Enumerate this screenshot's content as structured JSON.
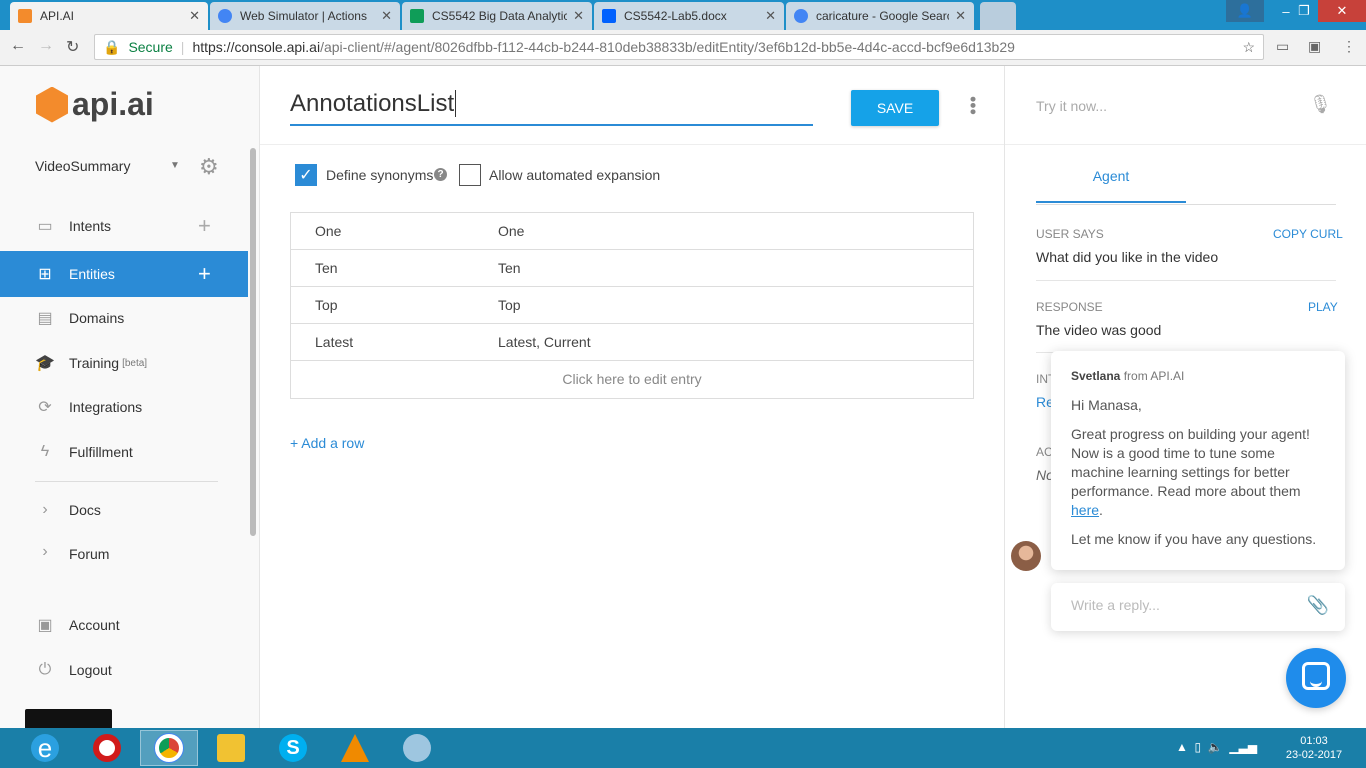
{
  "browser": {
    "tabs": [
      {
        "title": "API.AI",
        "color": "#f38b2c"
      },
      {
        "title": "Web Simulator | Actions",
        "color": "#4285f4"
      },
      {
        "title": "CS5542 Big Data Analytic",
        "color": "#0f9d58"
      },
      {
        "title": "CS5542-Lab5.docx",
        "color": "#0061fe"
      },
      {
        "title": "caricature - Google Searc",
        "color": "#4285f4"
      }
    ],
    "secure_label": "Secure",
    "url_main": "https://console.api.ai",
    "url_rest": "/api-client/#/agent/8026dfbb-f112-44cb-b244-810deb38833b/editEntity/3ef6b12d-bb5e-4d4c-accd-bcf9e6d13b29",
    "window_controls": {
      "min": "–",
      "max": "❐",
      "close": "✕"
    }
  },
  "sidebar": {
    "logo_text": "api.ai",
    "agent_name": "VideoSummary",
    "items": [
      {
        "label": "Intents",
        "icon": "chat-icon"
      },
      {
        "label": "Entities",
        "icon": "sitemap-icon"
      },
      {
        "label": "Domains",
        "icon": "book-icon"
      },
      {
        "label": "Training",
        "icon": "graduation-cap-icon",
        "badge": "[beta]"
      },
      {
        "label": "Integrations",
        "icon": "sync-icon"
      },
      {
        "label": "Fulfillment",
        "icon": "bolt-icon"
      },
      {
        "label": "Docs",
        "icon": "chevron-right-icon"
      },
      {
        "label": "Forum",
        "icon": "chevron-right-icon"
      },
      {
        "label": "Account",
        "icon": "person-icon"
      },
      {
        "label": "Logout",
        "icon": "power-icon"
      }
    ]
  },
  "main": {
    "entity_name": "AnnotationsList",
    "save_label": "SAVE",
    "define_synonyms_label": "Define synonyms",
    "allow_expansion_label": "Allow automated expansion",
    "define_synonyms_checked": true,
    "allow_expansion_checked": false,
    "rows": [
      {
        "value": "One",
        "synonyms": "One"
      },
      {
        "value": "Ten",
        "synonyms": "Ten"
      },
      {
        "value": "Top",
        "synonyms": "Top"
      },
      {
        "value": "Latest",
        "synonyms": "Latest, Current"
      }
    ],
    "edit_entry_label": "Click here to edit entry",
    "add_row_label": "+ Add a row"
  },
  "right": {
    "try_placeholder": "Try it now...",
    "tab_label": "Agent",
    "user_says_label": "USER SAYS",
    "copy_curl_label": "COPY CURL",
    "user_says_value": "What did you like in the video",
    "response_label": "RESPONSE",
    "play_label": "PLAY",
    "response_value": "The video was good",
    "intent_label_partial": "INT",
    "intent_value_partial": "Re",
    "action_label_partial": "AC",
    "action_value_partial": "No"
  },
  "chat": {
    "sender": "Svetlana",
    "from_text": "from API.AI",
    "greeting": "Hi Manasa,",
    "body": "Great progress on building your agent! Now is a good time to tune some machine learning settings for better performance. Read more about them",
    "link_text": "here",
    "closing": "Let me know if you have any questions.",
    "reply_placeholder": "Write a reply..."
  },
  "taskbar": {
    "apps": [
      {
        "name": "internet-explorer-icon",
        "color": "#2ba0e0"
      },
      {
        "name": "opera-icon",
        "color": "#d11b1b"
      },
      {
        "name": "chrome-icon",
        "color": "#f4b400"
      },
      {
        "name": "file-explorer-icon",
        "color": "#f1c232"
      },
      {
        "name": "skype-icon",
        "color": "#00aff0"
      },
      {
        "name": "vlc-icon",
        "color": "#f08a00"
      },
      {
        "name": "paint-icon",
        "color": "#9ec6e0"
      }
    ],
    "time": "01:03",
    "date": "23-02-2017"
  }
}
